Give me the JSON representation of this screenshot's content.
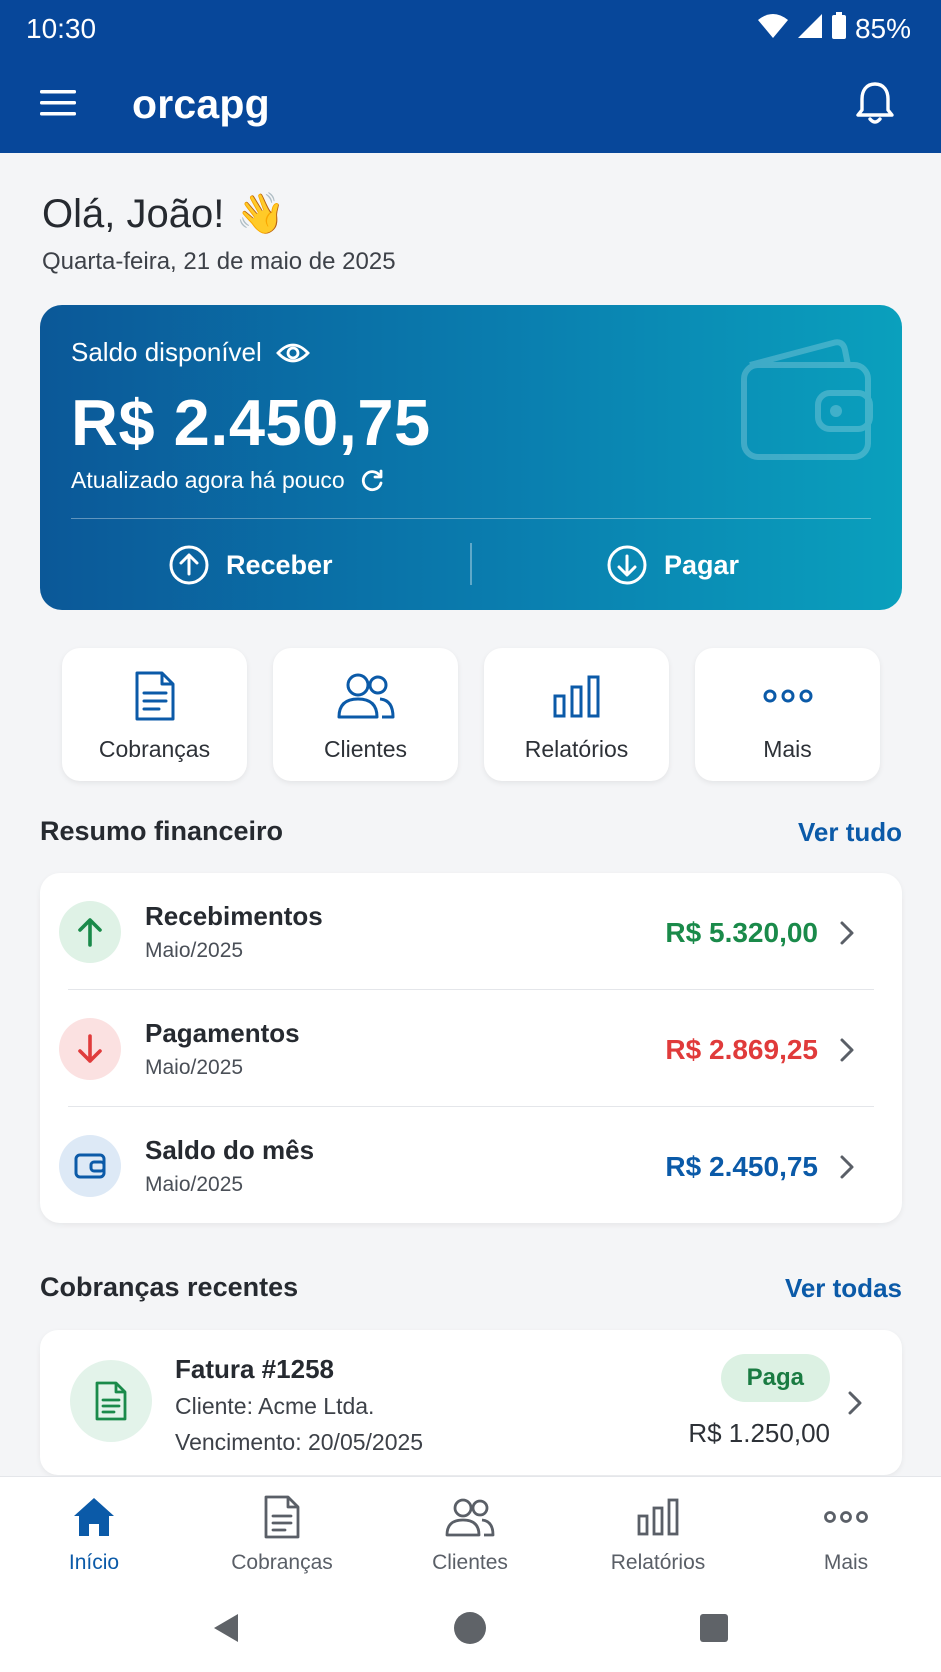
{
  "status_bar": {
    "time": "10:30",
    "battery": "85%"
  },
  "app": {
    "title": "orcapg"
  },
  "greeting": {
    "text": "Olá, João! 👋",
    "date": "Quarta-feira, 21 de maio de 2025"
  },
  "balance": {
    "label": "Saldo disponível",
    "value": "R$ 2.450,75",
    "updated": "Atualizado agora há pouco",
    "receive_label": "Receber",
    "pay_label": "Pagar"
  },
  "quick_actions": [
    {
      "label": "Cobranças",
      "icon": "document-icon"
    },
    {
      "label": "Clientes",
      "icon": "users-icon"
    },
    {
      "label": "Relatórios",
      "icon": "bar-chart-icon"
    },
    {
      "label": "Mais",
      "icon": "more-dots-icon"
    }
  ],
  "summary": {
    "title": "Resumo financeiro",
    "link": "Ver tudo",
    "rows": [
      {
        "title": "Recebimentos",
        "period": "Maio/2025",
        "amount": "R$ 5.320,00",
        "color": "#1a8a4a",
        "icon_bg": "#dff2e6",
        "icon": "arrow-up-icon"
      },
      {
        "title": "Pagamentos",
        "period": "Maio/2025",
        "amount": "R$ 2.869,25",
        "color": "#e03b3b",
        "icon_bg": "#fbe1e1",
        "icon": "arrow-down-icon"
      },
      {
        "title": "Saldo do mês",
        "period": "Maio/2025",
        "amount": "R$ 2.450,75",
        "color": "#0b5aa8",
        "icon_bg": "#dde9f6",
        "icon": "wallet-icon"
      }
    ]
  },
  "recent": {
    "title": "Cobranças recentes",
    "link": "Ver todas",
    "items": [
      {
        "title": "Fatura #1258",
        "client": "Cliente: Acme Ltda.",
        "due": "Vencimento: 20/05/2025",
        "status": "Paga",
        "amount": "R$ 1.250,00"
      }
    ]
  },
  "bottom_nav": [
    {
      "label": "Início",
      "icon": "home-icon",
      "active": true
    },
    {
      "label": "Cobranças",
      "icon": "document-icon"
    },
    {
      "label": "Clientes",
      "icon": "users-icon"
    },
    {
      "label": "Relatórios",
      "icon": "bar-chart-icon"
    },
    {
      "label": "Mais",
      "icon": "more-dots-icon"
    }
  ],
  "colors": {
    "primary": "#07479a",
    "accent": "#0b5aa8",
    "positive": "#1a8a4a",
    "negative": "#e03b3b"
  }
}
